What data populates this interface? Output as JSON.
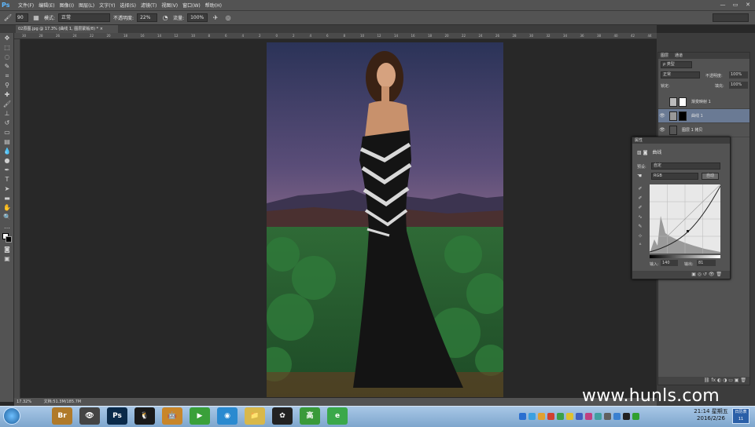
{
  "app": {
    "logo": "Ps",
    "brand_color": "#5fb8ff"
  },
  "menu": [
    "文件(F)",
    "编辑(E)",
    "图像(I)",
    "图层(L)",
    "文字(Y)",
    "选择(S)",
    "滤镜(T)",
    "视图(V)",
    "窗口(W)",
    "帮助(H)"
  ],
  "window_controls": [
    "—",
    "▭",
    "✕"
  ],
  "options": {
    "brush_size": "90",
    "mode_label": "模式:",
    "mode_value": "正常",
    "opacity_label": "不透明度:",
    "opacity_value": "22%",
    "flow_label": "流量:",
    "flow_value": "100%",
    "workspace": ""
  },
  "document": {
    "tab_title": "02原图.jpg @ 17.3% (曲线 1, 图层蒙版/8) *",
    "tab_close": "×"
  },
  "rulers": {
    "top": [
      "30",
      "28",
      "26",
      "24",
      "22",
      "20",
      "18",
      "16",
      "14",
      "12",
      "10",
      "8",
      "6",
      "4",
      "2",
      "0",
      "2",
      "4",
      "6",
      "8",
      "10",
      "12",
      "14",
      "16",
      "18",
      "20",
      "22",
      "24",
      "26",
      "28",
      "30",
      "32",
      "34",
      "36",
      "38",
      "40",
      "42",
      "44"
    ]
  },
  "status": {
    "zoom": "17.32%",
    "doc_info": "文档:51.3M/185.7M"
  },
  "layers_panel": {
    "tabs": [
      "图层",
      "通道"
    ],
    "filter_label": "ρ 类型",
    "blend_mode": "正常",
    "opacity_label": "不透明度:",
    "opacity_value": "100%",
    "lock_label": "锁定:",
    "fill_label": "填充:",
    "fill_value": "100%",
    "layers": [
      {
        "name": "渐变映射 1",
        "visible": false,
        "selected": false
      },
      {
        "name": "曲线 1",
        "visible": true,
        "selected": true
      },
      {
        "name": "图层 1 拷贝",
        "visible": true,
        "selected": false
      }
    ]
  },
  "properties": {
    "tab": "属性",
    "title": "曲线",
    "preset_label": "预设:",
    "preset_value": "自定",
    "channel_value": "RGB",
    "auto_button": "自动",
    "input_label": "输入:",
    "input_value": "140",
    "output_label": "输出:",
    "output_value": "81"
  },
  "watermark": "www.hunls.com",
  "taskbar": {
    "apps": [
      {
        "label": "Br",
        "color": "#b07a2a"
      },
      {
        "label": "👁",
        "color": "#444444"
      },
      {
        "label": "Ps",
        "color": "#0a2a4a"
      },
      {
        "label": "🐧",
        "color": "#1a1a1a"
      },
      {
        "label": "🤖",
        "color": "#c8862a"
      },
      {
        "label": "▶",
        "color": "#3aa03a"
      },
      {
        "label": "◉",
        "color": "#2a8ad0"
      },
      {
        "label": "📁",
        "color": "#d8b84a"
      },
      {
        "label": "✿",
        "color": "#222222"
      },
      {
        "label": "高",
        "color": "#3a9a3a"
      },
      {
        "label": "e",
        "color": "#3aa84a"
      }
    ],
    "clock_time": "21:14 星期五",
    "clock_date": "2016/2/26",
    "calendar_top": "日历表",
    "calendar_day": "11"
  }
}
